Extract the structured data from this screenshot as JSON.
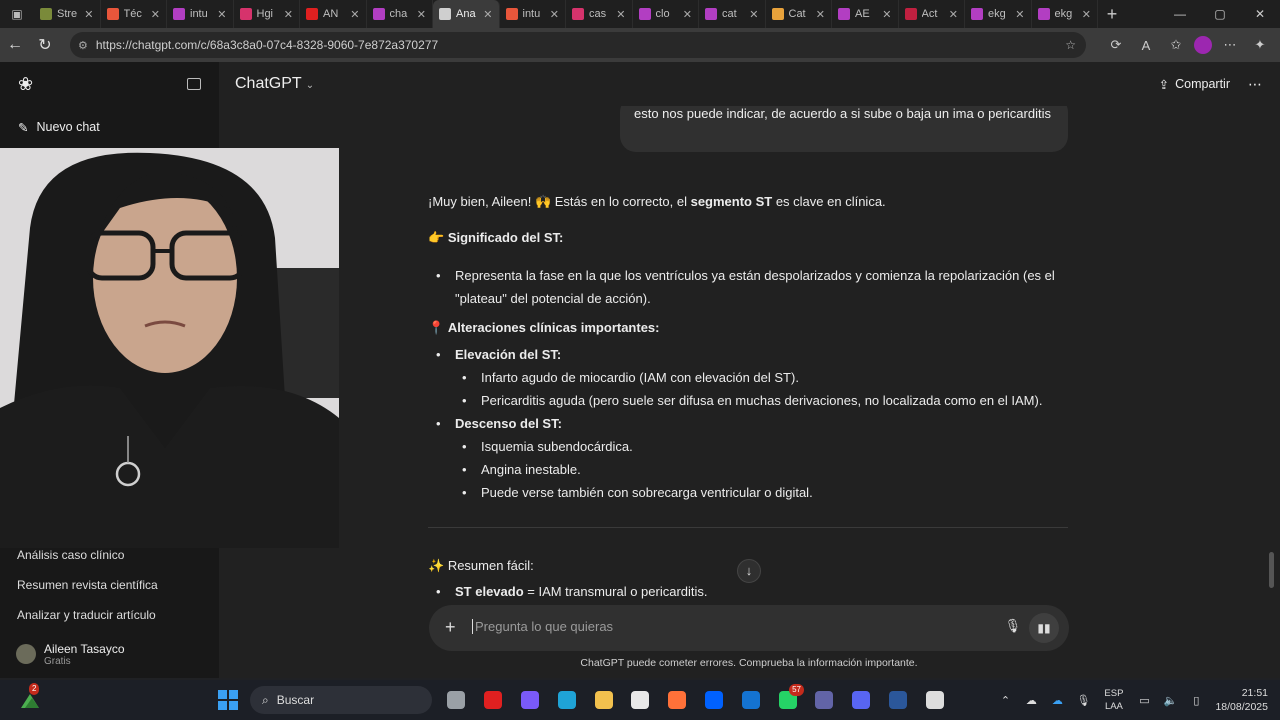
{
  "browser": {
    "tabs": [
      {
        "title": "Stre",
        "color": "#7a8a3a"
      },
      {
        "title": "Téc",
        "color": "#e8563b"
      },
      {
        "title": "intu",
        "color": "#b23ec2"
      },
      {
        "title": "Hgi",
        "color": "#d6336c"
      },
      {
        "title": "AN",
        "color": "#e02020"
      },
      {
        "title": "cha",
        "color": "#b23ec2"
      },
      {
        "title": "Ana",
        "color": "#cfcfcf",
        "active": true
      },
      {
        "title": "intu",
        "color": "#e8563b"
      },
      {
        "title": "cas",
        "color": "#d6336c"
      },
      {
        "title": "clo",
        "color": "#b23ec2"
      },
      {
        "title": "cat",
        "color": "#b23ec2"
      },
      {
        "title": "Cat",
        "color": "#e8a23b"
      },
      {
        "title": "AE",
        "color": "#b23ec2"
      },
      {
        "title": "Act",
        "color": "#c02040"
      },
      {
        "title": "ekg",
        "color": "#b23ec2"
      },
      {
        "title": "ekg",
        "color": "#b23ec2"
      }
    ],
    "url": "https://chatgpt.com/c/68a3c8a0-07c4-8328-9060-7e872a370277"
  },
  "sidebar": {
    "new_chat": "Nuevo chat",
    "items": [
      "Análisis caso clínico",
      "Resumen revista científica",
      "Analizar y traducir artículo"
    ],
    "user_name": "Aileen Tasayco",
    "user_plan": "Gratis"
  },
  "header": {
    "model": "ChatGPT",
    "share": "Compartir"
  },
  "conversation": {
    "user_message": "esto nos puede indicar, de acuerdo a si sube o baja un ima o pericarditis",
    "intro_pre": "¡Muy bien, Aileen! 🙌 Estás en lo correcto, el ",
    "intro_bold": "segmento ST",
    "intro_post": " es clave en clínica.",
    "h1_emoji": "👉",
    "h1": "Significado del ST:",
    "meaning": "Representa la fase en la que los ventrículos ya están despolarizados y comienza la repolarización (es el \"plateau\" del potencial de acción).",
    "h2_emoji": "📍",
    "h2": "Alteraciones clínicas importantes:",
    "elev_title": "Elevación del ST:",
    "elev_items": [
      "Infarto agudo de miocardio (IAM con elevación del ST).",
      "Pericarditis aguda (pero suele ser difusa en muchas derivaciones, no localizada como en el IAM)."
    ],
    "desc_title": "Descenso del ST:",
    "desc_items": [
      "Isquemia subendocárdica.",
      "Angina inestable.",
      "Puede verse también con sobrecarga ventricular o digital."
    ],
    "h3_emoji": "✨",
    "h3": "Resumen fácil:",
    "summary_bold": "ST elevado",
    "summary_rest": " = IAM transmural o pericarditis."
  },
  "composer": {
    "placeholder": "Pregunta lo que quieras",
    "disclaimer": "ChatGPT puede cometer errores. Comprueba la información importante."
  },
  "taskbar": {
    "search": "Buscar",
    "left_badge": "2",
    "whatsapp_badge": "57",
    "lang_1": "ESP",
    "lang_2": "LAA",
    "time": "21:51",
    "date": "18/08/2025",
    "apps": [
      {
        "name": "task-view",
        "color": "#9aa0a6"
      },
      {
        "name": "youtube",
        "color": "#e02020"
      },
      {
        "name": "copilot",
        "color": "#7a5af8"
      },
      {
        "name": "edge",
        "color": "#1fa3d6"
      },
      {
        "name": "file-explorer",
        "color": "#f2c14e"
      },
      {
        "name": "store",
        "color": "#e8e8e8"
      },
      {
        "name": "firefox",
        "color": "#ff7139"
      },
      {
        "name": "dropbox",
        "color": "#0061fe"
      },
      {
        "name": "outlook",
        "color": "#1473d1"
      },
      {
        "name": "whatsapp",
        "color": "#25d366"
      },
      {
        "name": "teams",
        "color": "#6264a7"
      },
      {
        "name": "discord",
        "color": "#5865f2"
      },
      {
        "name": "word",
        "color": "#2b579a"
      },
      {
        "name": "chatgpt",
        "color": "#dddddd"
      }
    ]
  }
}
